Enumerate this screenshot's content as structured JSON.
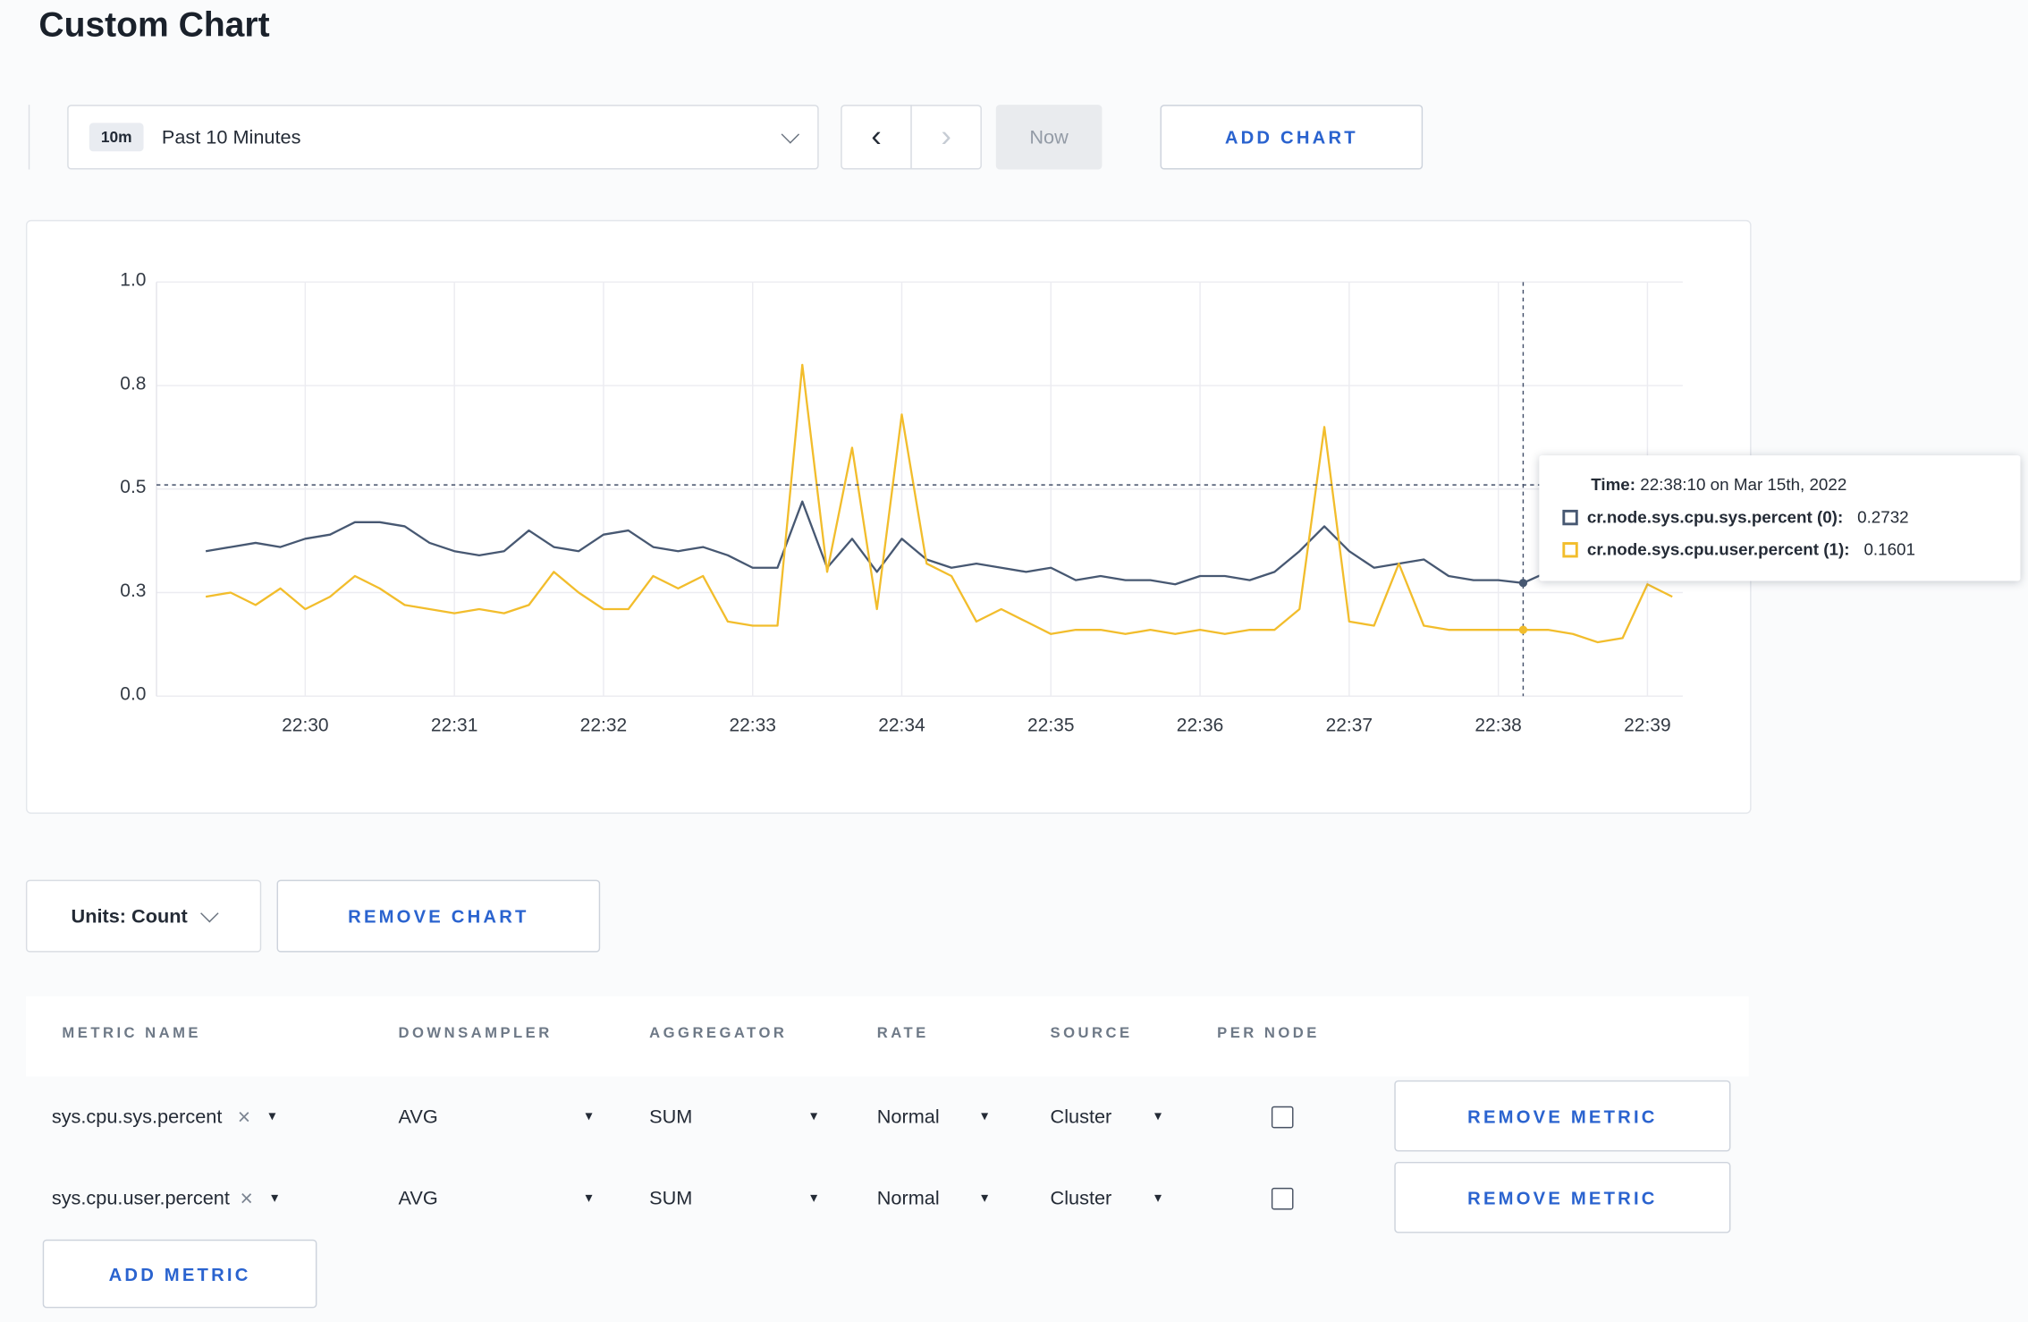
{
  "page": {
    "title": "Custom Chart"
  },
  "icons": {
    "prev": "‹",
    "next": "›",
    "caret": "▾",
    "clear": "×"
  },
  "toolbar": {
    "time_range": {
      "badge": "10m",
      "label": "Past 10 Minutes"
    },
    "now_label": "Now",
    "add_chart_label": "ADD CHART"
  },
  "chart": {
    "tooltip": {
      "time_label": "Time:",
      "time_value": "22:38:10 on Mar 15th, 2022",
      "series": [
        {
          "name": "cr.node.sys.cpu.sys.percent (0):",
          "value": "0.2732"
        },
        {
          "name": "cr.node.sys.cpu.user.percent (1):",
          "value": "0.1601"
        }
      ]
    }
  },
  "chart_data": {
    "type": "line",
    "title": "",
    "xlabel": "",
    "ylabel": "",
    "ylim": [
      0,
      1.0
    ],
    "y_ticks": [
      0,
      0.25,
      0.5,
      0.75,
      1.0
    ],
    "y_tick_labels": [
      "0.0",
      "0.3",
      "0.5",
      "0.8",
      "1.0"
    ],
    "x_ticks": [
      "22:30",
      "22:31",
      "22:32",
      "22:33",
      "22:34",
      "22:35",
      "22:36",
      "22:37",
      "22:38",
      "22:39"
    ],
    "x_start_time": "22:29:20",
    "start_offset_seconds": -40,
    "step_seconds": 10,
    "grid": true,
    "legend": "none",
    "series": [
      {
        "name": "cr.node.sys.cpu.sys.percent",
        "color": "#475872",
        "values": [
          0.35,
          0.36,
          0.37,
          0.36,
          0.38,
          0.39,
          0.42,
          0.42,
          0.41,
          0.37,
          0.35,
          0.34,
          0.35,
          0.4,
          0.36,
          0.35,
          0.39,
          0.4,
          0.36,
          0.35,
          0.36,
          0.34,
          0.31,
          0.31,
          0.47,
          0.31,
          0.38,
          0.3,
          0.38,
          0.33,
          0.31,
          0.32,
          0.31,
          0.3,
          0.31,
          0.28,
          0.29,
          0.28,
          0.28,
          0.27,
          0.29,
          0.29,
          0.28,
          0.3,
          0.35,
          0.41,
          0.35,
          0.31,
          0.32,
          0.33,
          0.29,
          0.28,
          0.28,
          0.2732,
          0.3,
          0.31,
          0.3,
          0.29,
          0.3,
          0.31
        ]
      },
      {
        "name": "cr.node.sys.cpu.user.percent",
        "color": "#f2bd2c",
        "values": [
          0.24,
          0.25,
          0.22,
          0.26,
          0.21,
          0.24,
          0.29,
          0.26,
          0.22,
          0.21,
          0.2,
          0.21,
          0.2,
          0.22,
          0.3,
          0.25,
          0.21,
          0.21,
          0.29,
          0.26,
          0.29,
          0.18,
          0.17,
          0.17,
          0.8,
          0.3,
          0.6,
          0.21,
          0.68,
          0.32,
          0.29,
          0.18,
          0.21,
          0.18,
          0.15,
          0.16,
          0.16,
          0.15,
          0.16,
          0.15,
          0.16,
          0.15,
          0.16,
          0.16,
          0.21,
          0.65,
          0.18,
          0.17,
          0.32,
          0.17,
          0.16,
          0.16,
          0.16,
          0.1601,
          0.16,
          0.15,
          0.13,
          0.14,
          0.27,
          0.24
        ]
      }
    ],
    "crosshair": {
      "time": "22:38:10",
      "seconds_from_first_tick": 490,
      "hline_value": 0.51,
      "marker_values": [
        0.2732,
        0.1601
      ]
    }
  },
  "units_row": {
    "units_label": "Units: Count",
    "remove_chart_label": "REMOVE CHART"
  },
  "metrics_table": {
    "headers": [
      "METRIC NAME",
      "DOWNSAMPLER",
      "AGGREGATOR",
      "RATE",
      "SOURCE",
      "PER NODE"
    ],
    "rows": [
      {
        "metric": "sys.cpu.sys.percent",
        "downsampler": "AVG",
        "aggregator": "SUM",
        "rate": "Normal",
        "source": "Cluster",
        "per_node": false,
        "remove_label": "REMOVE METRIC"
      },
      {
        "metric": "sys.cpu.user.percent",
        "downsampler": "AVG",
        "aggregator": "SUM",
        "rate": "Normal",
        "source": "Cluster",
        "per_node": false,
        "remove_label": "REMOVE METRIC"
      }
    ],
    "add_metric_label": "ADD METRIC"
  }
}
